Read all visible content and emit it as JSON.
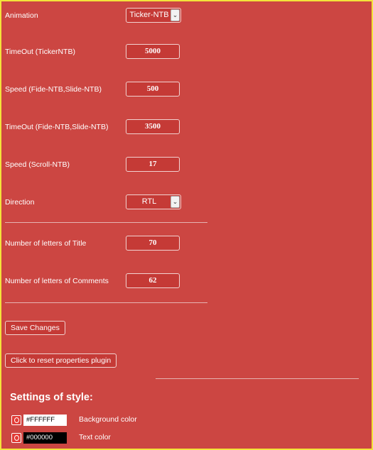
{
  "settings": {
    "animation": {
      "label": "Animation",
      "value": "Ticker-NTB"
    },
    "timeout_ticker": {
      "label": "TimeOut (TickerNTB)",
      "value": "5000"
    },
    "speed_fade_slide": {
      "label": "Speed (Fide-NTB,Slide-NTB)",
      "value": "500"
    },
    "timeout_fade_slide": {
      "label": "TimeOut (Fide-NTB,Slide-NTB)",
      "value": "3500"
    },
    "speed_scroll": {
      "label": "Speed (Scroll-NTB)",
      "value": "17"
    },
    "direction": {
      "label": "Direction",
      "value": "RTL"
    },
    "title_letters": {
      "label": "Number of letters of Title",
      "value": "70"
    },
    "comment_letters": {
      "label": "Number of letters of Comments",
      "value": "62"
    }
  },
  "buttons": {
    "save": "Save Changes",
    "reset": "Click to reset properties plugin"
  },
  "style_section": {
    "heading": "Settings of style:",
    "background": {
      "value": "#FFFFFF",
      "label": "Background color"
    },
    "text": {
      "value": "#000000",
      "label": "Text color"
    }
  },
  "colors": {
    "page_bg": "#cc4642",
    "border": "#f3e33a"
  },
  "icons": {
    "select_caret": "chevron-down-icon",
    "color_picker": "color-picker-icon"
  }
}
